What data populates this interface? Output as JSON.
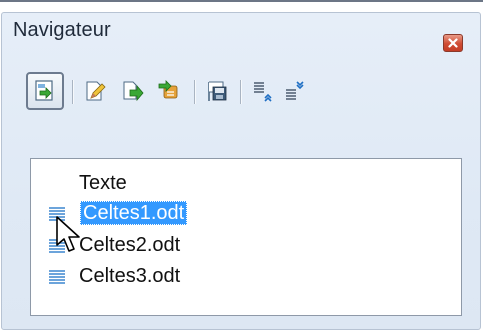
{
  "window": {
    "title": "Navigateur"
  },
  "toolbar": {
    "buttons": [
      {
        "name": "toggle",
        "icon": "navigator-toggle-icon"
      },
      {
        "name": "edit",
        "icon": "edit-pencil-icon"
      },
      {
        "name": "update",
        "icon": "update-arrow-icon"
      },
      {
        "name": "insert",
        "icon": "insert-icon"
      },
      {
        "name": "save-as",
        "icon": "save-as-icon"
      },
      {
        "name": "move-up",
        "icon": "move-up-icon"
      },
      {
        "name": "move-down",
        "icon": "move-down-icon"
      }
    ]
  },
  "tree": {
    "heading": "Texte",
    "items": [
      {
        "label": "Celtes1.odt",
        "selected": true
      },
      {
        "label": "Celtes2.odt",
        "selected": false
      },
      {
        "label": "Celtes3.odt",
        "selected": false
      }
    ]
  },
  "colors": {
    "selection": "#3399ff",
    "panel_bg": "#dfe9f5",
    "close_red": "#cf4b33"
  }
}
